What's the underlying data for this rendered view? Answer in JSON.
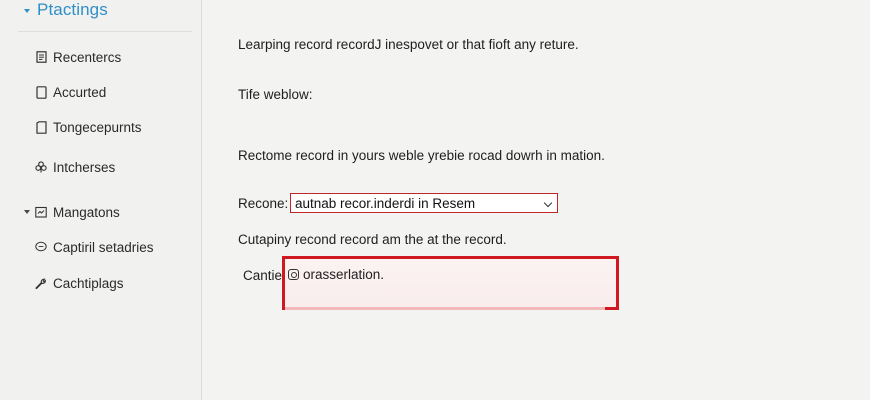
{
  "sidebar": {
    "title": "Ptactings",
    "items": [
      {
        "label": "Recentercs",
        "icon": "document-icon"
      },
      {
        "label": "Accurted",
        "icon": "rectangle-icon"
      },
      {
        "label": "Tongecepurnts",
        "icon": "page-icon"
      },
      {
        "label": "Intcherses",
        "icon": "flower-icon"
      },
      {
        "label": "Mangatons",
        "icon": "folder-icon",
        "expandable": true
      },
      {
        "label": "Captiril setadries",
        "icon": "speech-bubble-icon"
      },
      {
        "label": "Cachtiplags",
        "icon": "wrench-icon"
      }
    ]
  },
  "main": {
    "intro": "Learping record recordJ inespovet or that fioft any reture.",
    "subheading": "Tife weblow:",
    "description": "Rectome record in yours weble yrebie rocad dowrh in mation.",
    "select": {
      "label": "Recone:",
      "value": "autnab recor.inderdi in Resem"
    },
    "caption": "Cutapiny recond record am the at the record.",
    "callout": {
      "label": "Cantie",
      "text": "orasserlation."
    }
  },
  "colors": {
    "accent": "#2f8fc9",
    "highlight_border": "#d01820",
    "select_border": "#c2262d"
  }
}
